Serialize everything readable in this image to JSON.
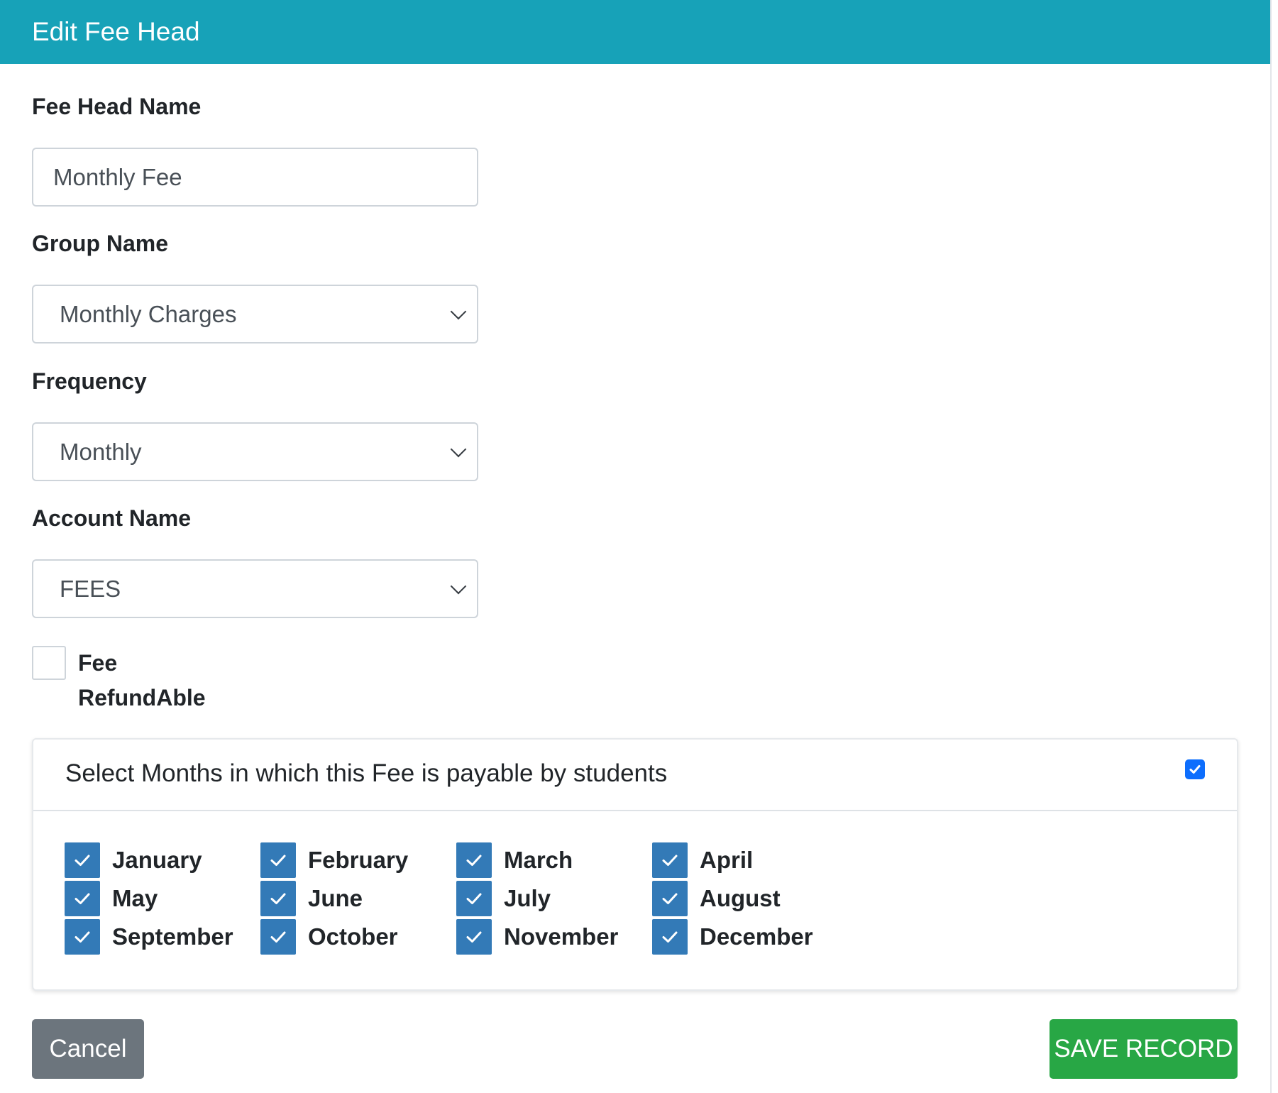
{
  "modal": {
    "title": "Edit Fee Head"
  },
  "form": {
    "fee_head_name": {
      "label": "Fee Head Name",
      "value": "Monthly Fee"
    },
    "group_name": {
      "label": "Group Name",
      "value": "Monthly Charges"
    },
    "frequency": {
      "label": "Frequency",
      "value": "Monthly"
    },
    "account_name": {
      "label": "Account Name",
      "value": "FEES"
    },
    "refundable": {
      "label_line1": "Fee",
      "label_line2": "RefundAble",
      "checked": false
    }
  },
  "months_card": {
    "title": "Select Months in which this Fee is payable by students",
    "select_all_checked": true,
    "months": [
      {
        "label": "January",
        "checked": true
      },
      {
        "label": "February",
        "checked": true
      },
      {
        "label": "March",
        "checked": true
      },
      {
        "label": "April",
        "checked": true
      },
      {
        "label": "May",
        "checked": true
      },
      {
        "label": "June",
        "checked": true
      },
      {
        "label": "July",
        "checked": true
      },
      {
        "label": "August",
        "checked": true
      },
      {
        "label": "September",
        "checked": true
      },
      {
        "label": "October",
        "checked": true
      },
      {
        "label": "November",
        "checked": true
      },
      {
        "label": "December",
        "checked": true
      }
    ]
  },
  "footer": {
    "cancel_label": "Cancel",
    "save_label": "SAVE RECORD"
  },
  "colors": {
    "header": "#17a2b8",
    "checkbox": "#337ab7",
    "master_checkbox": "#0d6efd",
    "save": "#28a745",
    "cancel": "#6c757d"
  }
}
